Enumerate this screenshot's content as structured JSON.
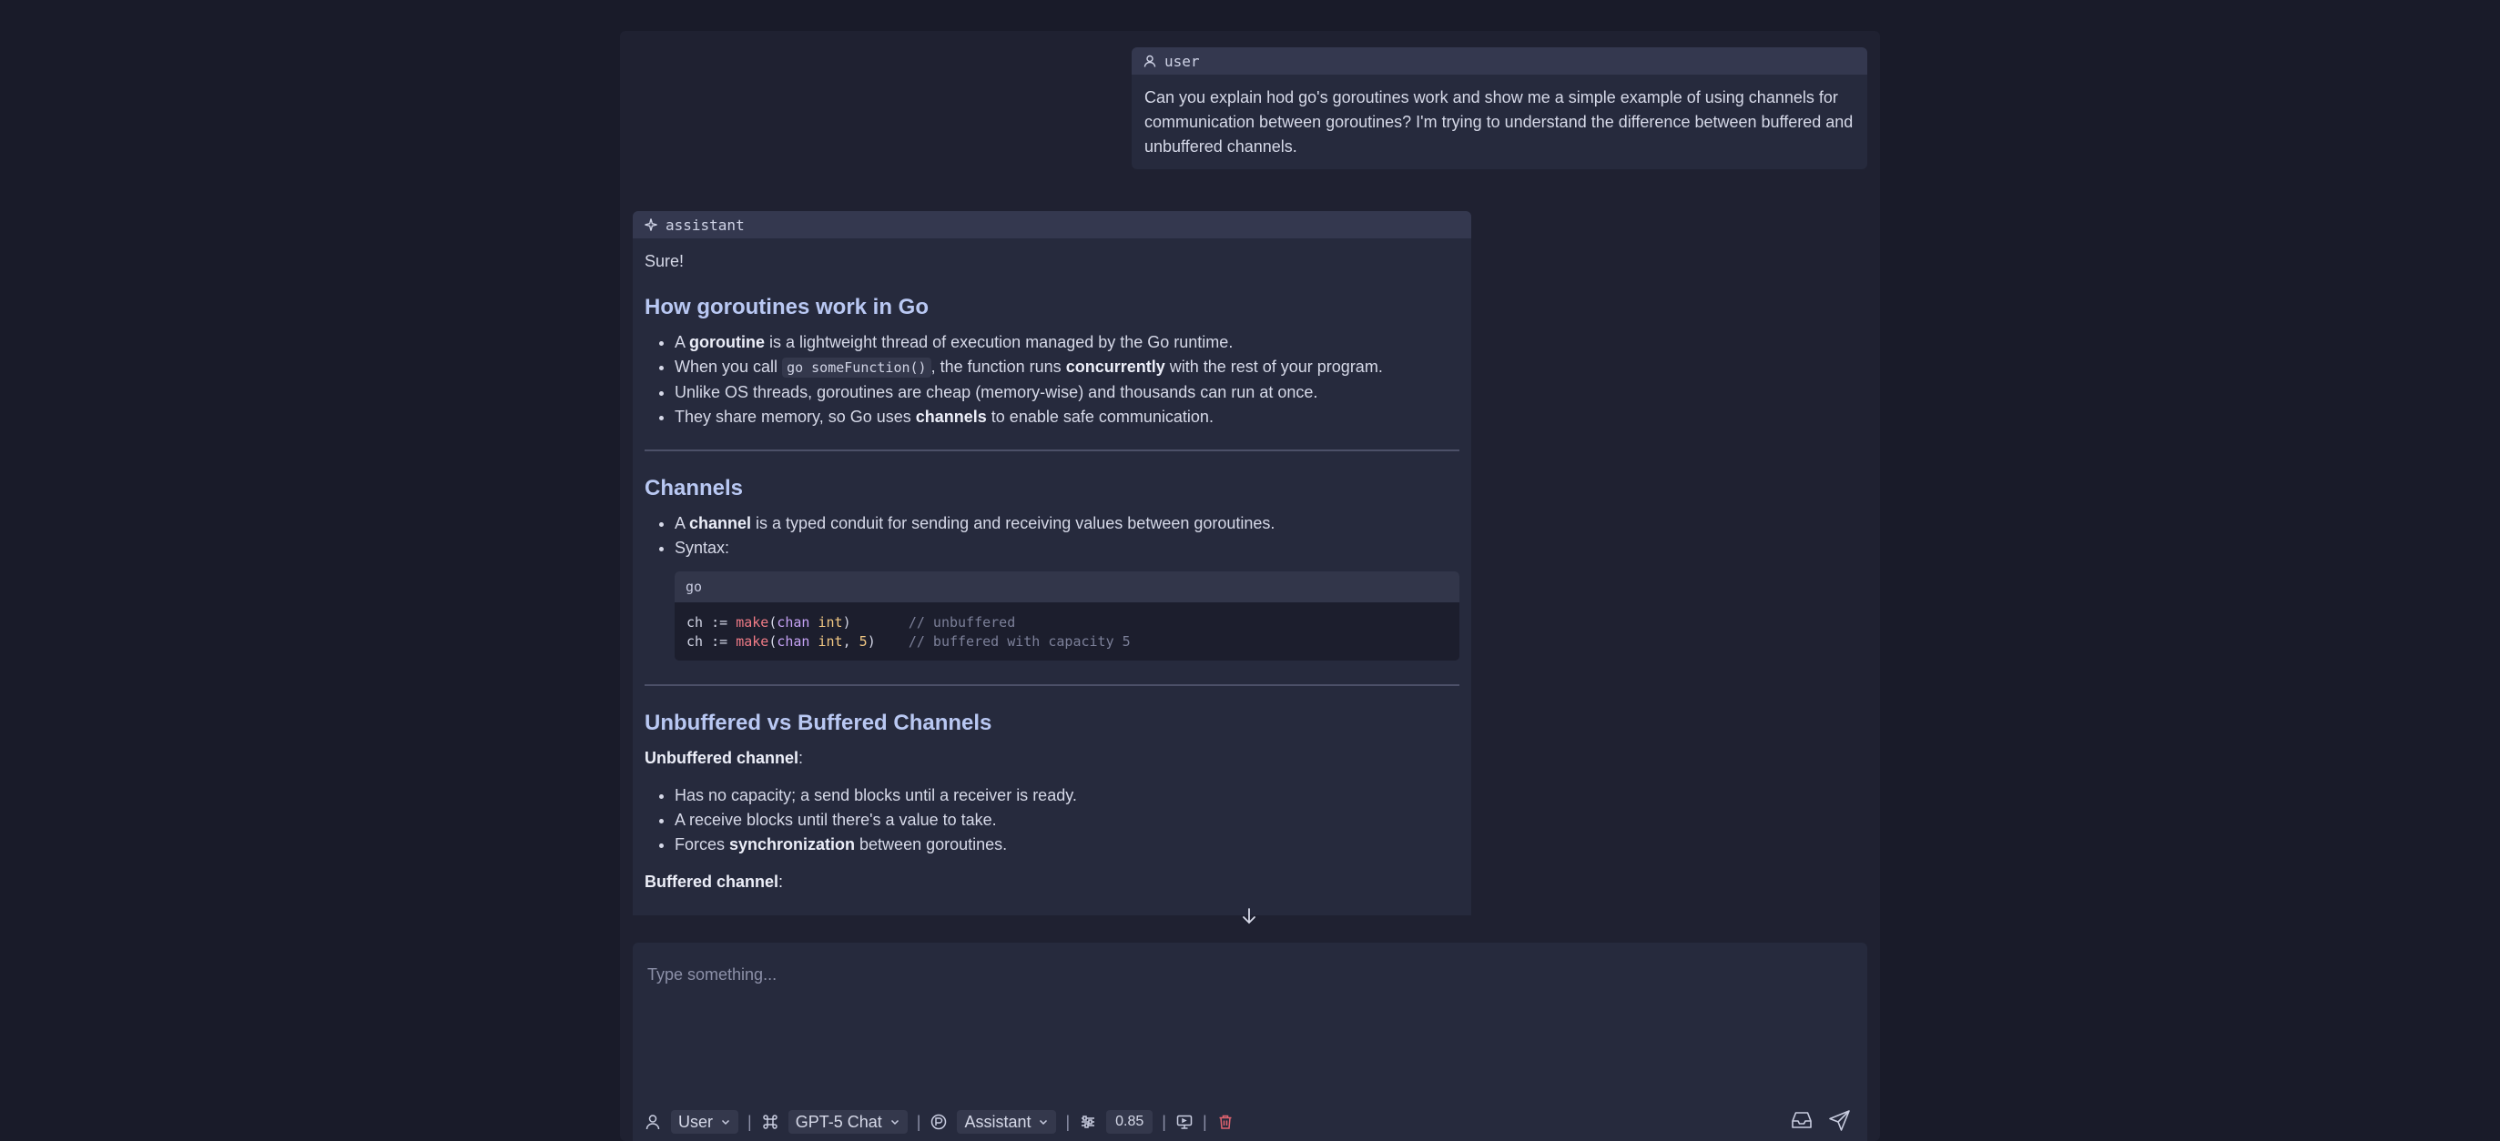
{
  "conversation": {
    "user_role": "user",
    "user_message": "Can you explain hod go's goroutines work and show me a simple example of using channels for communication between goroutines? I'm trying to understand the difference between buffered and unbuffered channels.",
    "assistant_role": "assistant",
    "assistant": {
      "intro": "Sure!",
      "h1": "How goroutines work in Go",
      "g_items": {
        "i1_a": "A ",
        "i1_b": "goroutine",
        "i1_c": " is a lightweight thread of execution managed by the Go runtime.",
        "i2_a": "When you call ",
        "i2_code": "go someFunction()",
        "i2_b": ", the function runs ",
        "i2_c": "concurrently",
        "i2_d": " with the rest of your program.",
        "i3": "Unlike OS threads, goroutines are cheap (memory-wise) and thousands can run at once.",
        "i4_a": "They share memory, so Go uses ",
        "i4_b": "channels",
        "i4_c": " to enable safe communication."
      },
      "h2": "Channels",
      "c_items": {
        "i1_a": "A ",
        "i1_b": "channel",
        "i1_c": " is a typed conduit for sending and receiving values between goroutines.",
        "i2": "Syntax:"
      },
      "code": {
        "lang": "go",
        "l1_var": "ch := ",
        "l1_fn": "make",
        "l1_p1": "(",
        "l1_kw": "chan",
        "l1_sp": " ",
        "l1_ty": "int",
        "l1_p2": ")",
        "l1_pad": "       ",
        "l1_cm": "// unbuffered",
        "l2_var": "ch := ",
        "l2_fn": "make",
        "l2_p1": "(",
        "l2_kw": "chan",
        "l2_sp": " ",
        "l2_ty": "int",
        "l2_comma": ", ",
        "l2_num": "5",
        "l2_p2": ")",
        "l2_pad": "    ",
        "l2_cm": "// buffered with capacity 5"
      },
      "h3": "Unbuffered vs Buffered Channels",
      "unbuf_label": "Unbuffered channel",
      "unbuf_colon": ":",
      "u_items": {
        "i1": "Has no capacity; a send blocks until a receiver is ready.",
        "i2": "A receive blocks until there's a value to take.",
        "i3_a": "Forces ",
        "i3_b": "synchronization",
        "i3_c": " between goroutines."
      },
      "buf_label": "Buffered channel",
      "buf_colon": ":"
    }
  },
  "composer": {
    "placeholder": "Type something...",
    "role_select": "User",
    "model_select": "GPT-5 Chat",
    "persona_select": "Assistant",
    "temperature": "0.85"
  },
  "colors": {
    "background": "#191b29",
    "panel": "#1f2131",
    "heading": "#b9c8f3",
    "delete_icon": "#e0636f"
  }
}
